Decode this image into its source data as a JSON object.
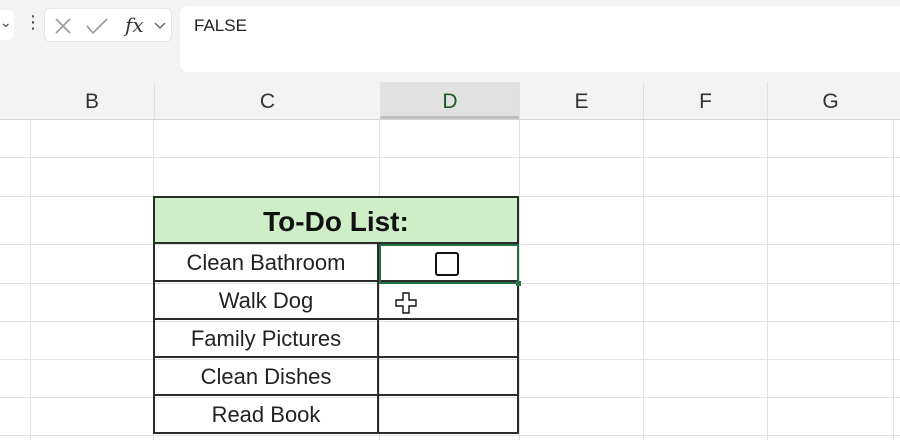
{
  "formula_bar": {
    "value": "FALSE",
    "fx_label": "fx"
  },
  "columns": [
    "B",
    "C",
    "D",
    "E",
    "F",
    "G"
  ],
  "selected_column": "D",
  "todo": {
    "title": "To-Do List:",
    "items": [
      "Clean Bathroom",
      "Walk Dog",
      "Family Pictures",
      "Clean Dishes",
      "Read Book"
    ]
  },
  "colors": {
    "header_fill": "#cdeec6",
    "selection": "#217346"
  },
  "icons": [
    "chevron-down-icon",
    "more-options-icon",
    "cancel-icon",
    "enter-icon",
    "insert-function-icon",
    "checkbox-icon",
    "move-cursor-icon"
  ]
}
